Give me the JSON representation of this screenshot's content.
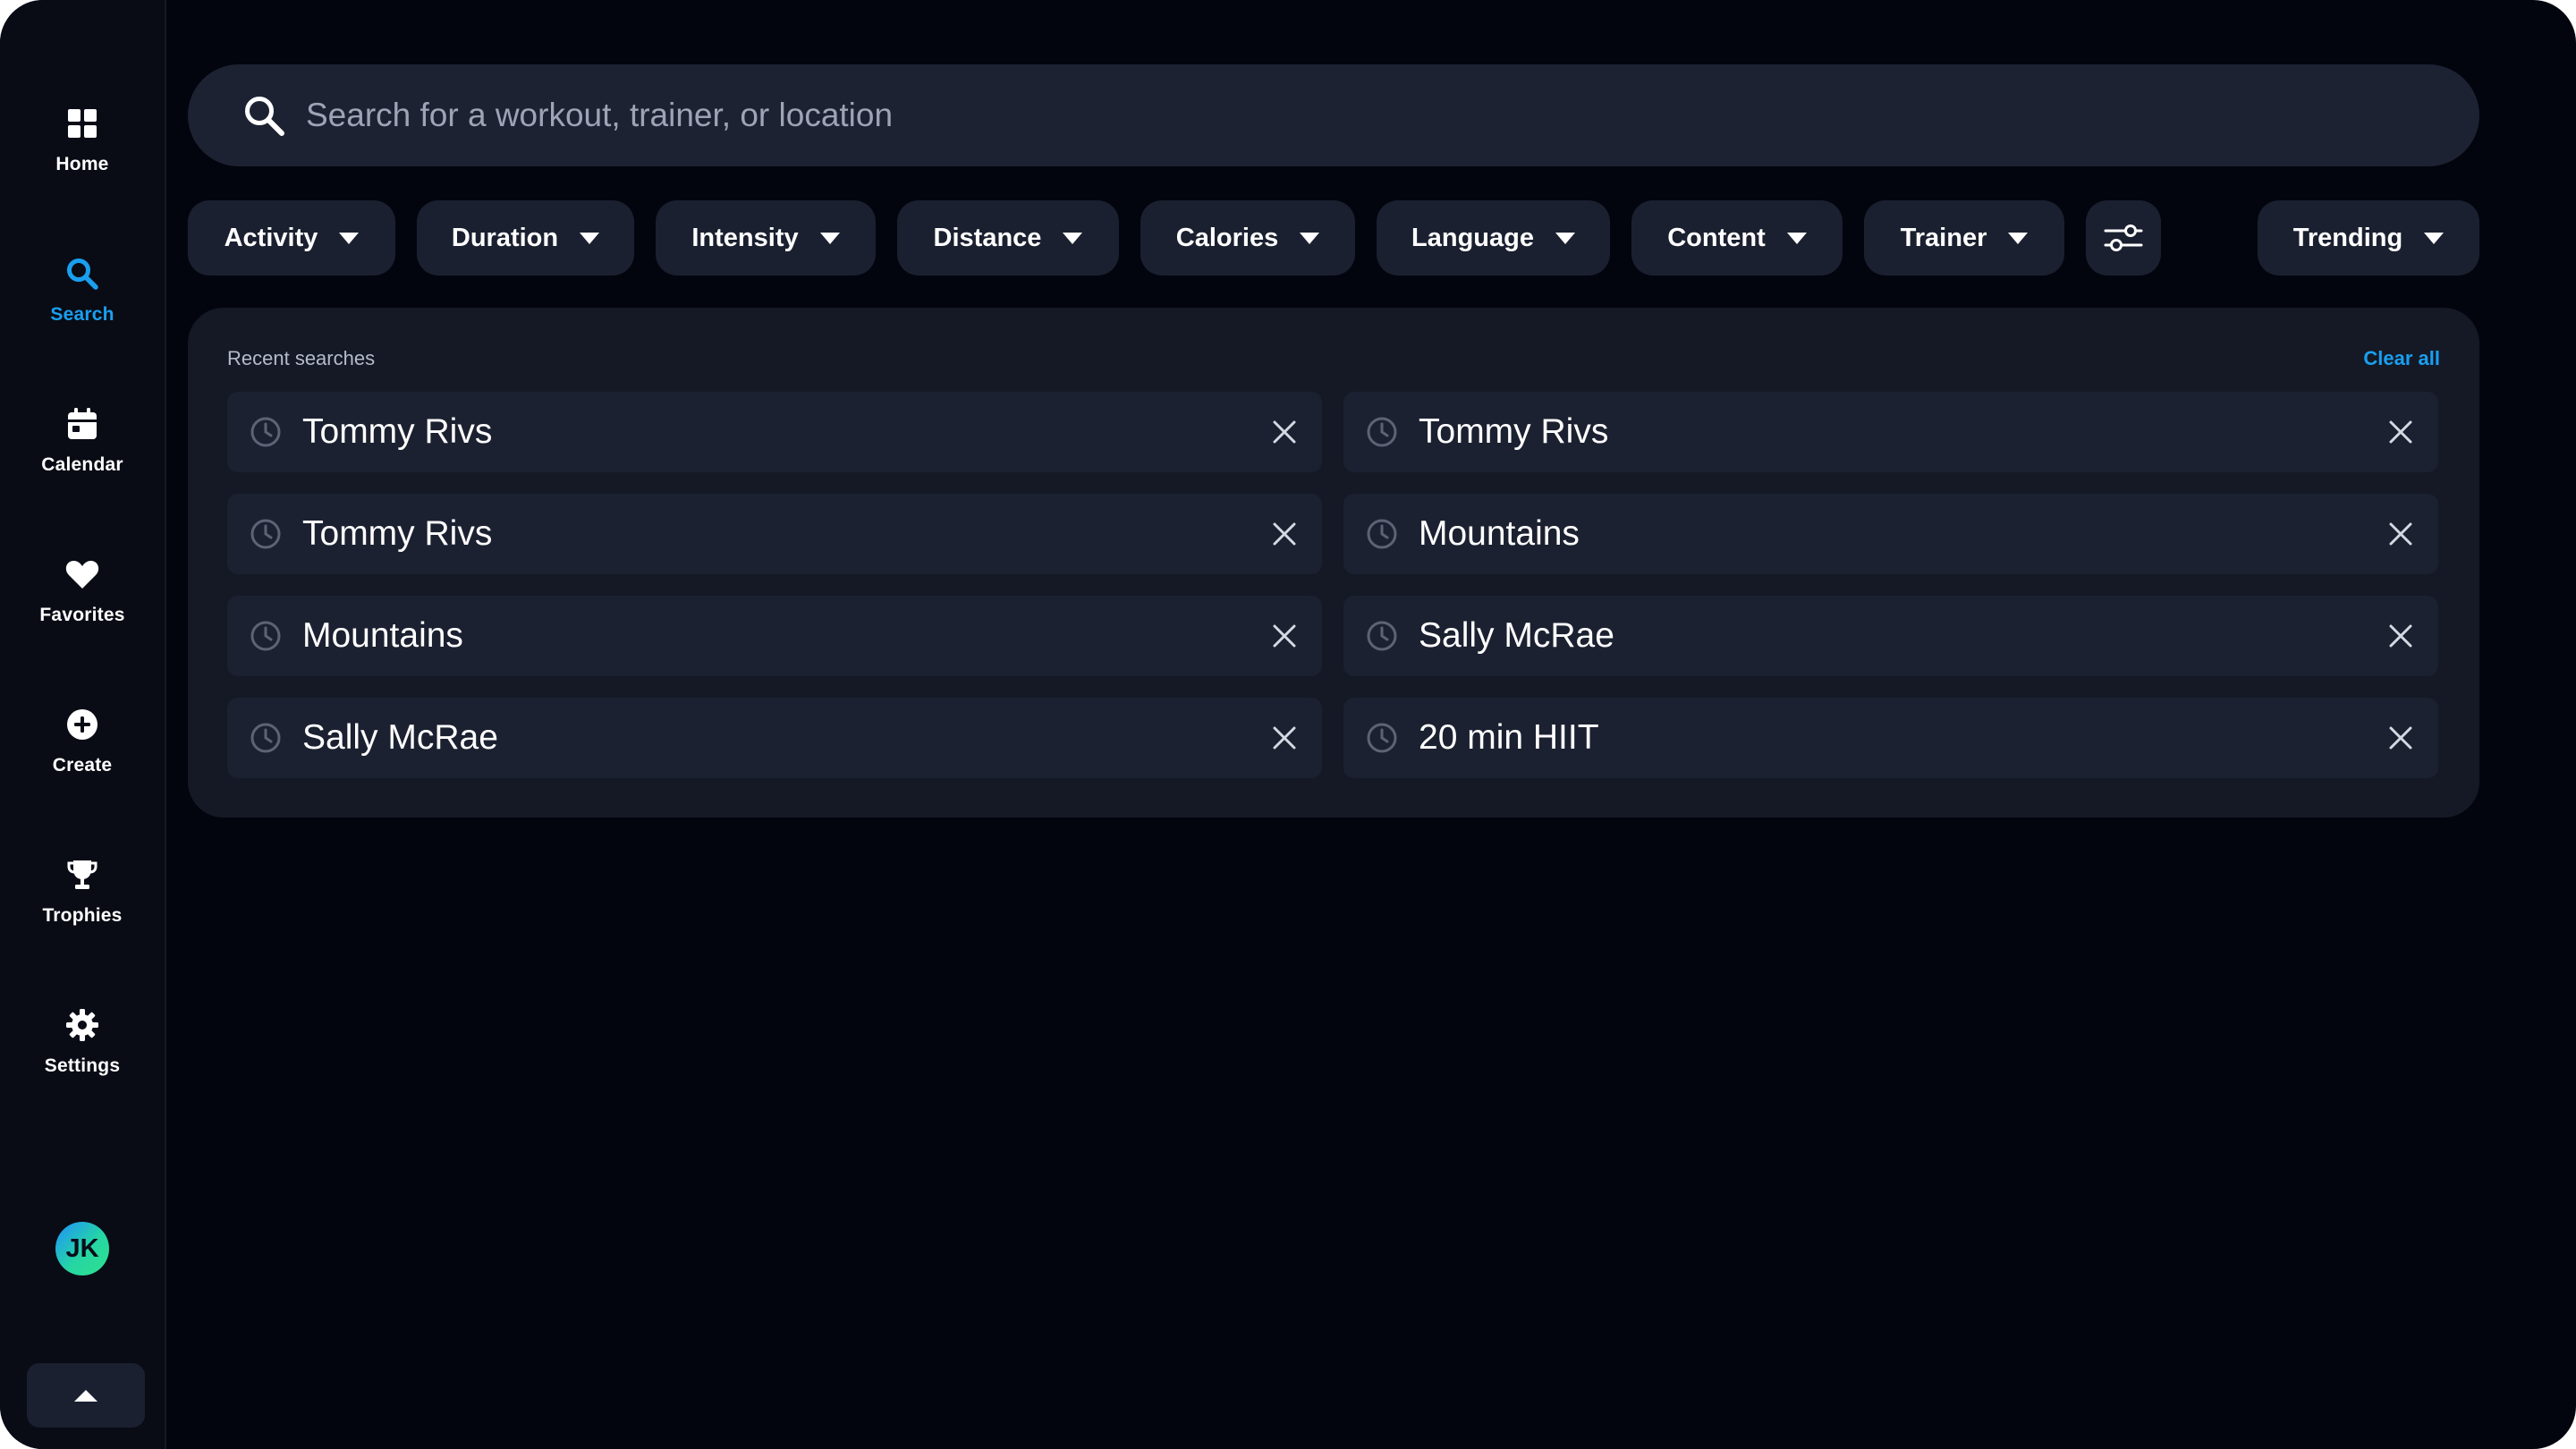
{
  "sidebar": {
    "items": [
      {
        "label": "Home",
        "icon": "grid-icon"
      },
      {
        "label": "Search",
        "icon": "search-icon"
      },
      {
        "label": "Calendar",
        "icon": "calendar-icon"
      },
      {
        "label": "Favorites",
        "icon": "heart-icon"
      },
      {
        "label": "Create",
        "icon": "plus-circle-icon"
      },
      {
        "label": "Trophies",
        "icon": "trophy-icon"
      },
      {
        "label": "Settings",
        "icon": "gear-icon"
      }
    ],
    "active": "Search",
    "avatar_initials": "JK"
  },
  "search": {
    "placeholder": "Search for a workout, trainer, or location",
    "value": ""
  },
  "filters": {
    "chips": [
      "Activity",
      "Duration",
      "Intensity",
      "Distance",
      "Calories",
      "Language",
      "Content",
      "Trainer"
    ],
    "sort": "Trending"
  },
  "recent": {
    "title": "Recent searches",
    "clear_label": "Clear all",
    "items": [
      "Tommy Rivs",
      "Tommy Rivs",
      "Tommy Rivs",
      "Mountains",
      "Mountains",
      "Sally McRae",
      "Sally McRae",
      "20 min HIIT"
    ]
  },
  "colors": {
    "background": "#03050e",
    "sidebar": "#090c15",
    "surface": "#1b2030",
    "accent": "#1a9ff0"
  }
}
